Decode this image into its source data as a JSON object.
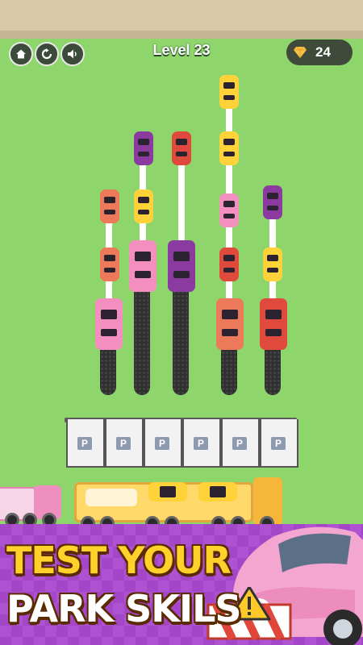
{
  "hud": {
    "level_label": "Level 23",
    "gem_count": "24",
    "buttons": [
      "home-icon",
      "restart-icon",
      "sound-icon"
    ]
  },
  "parking_slot_label": "P",
  "promo": {
    "line1": "TEST YOUR",
    "line2": "PARK SKILS"
  },
  "colors": {
    "grass": "#8ed66c",
    "yellow": "#ffd23a",
    "purple": "#8b3aa0",
    "red": "#e04a3c",
    "salmon": "#ec7a5a",
    "pink": "#f28fbf",
    "banner": "#a347c8"
  }
}
